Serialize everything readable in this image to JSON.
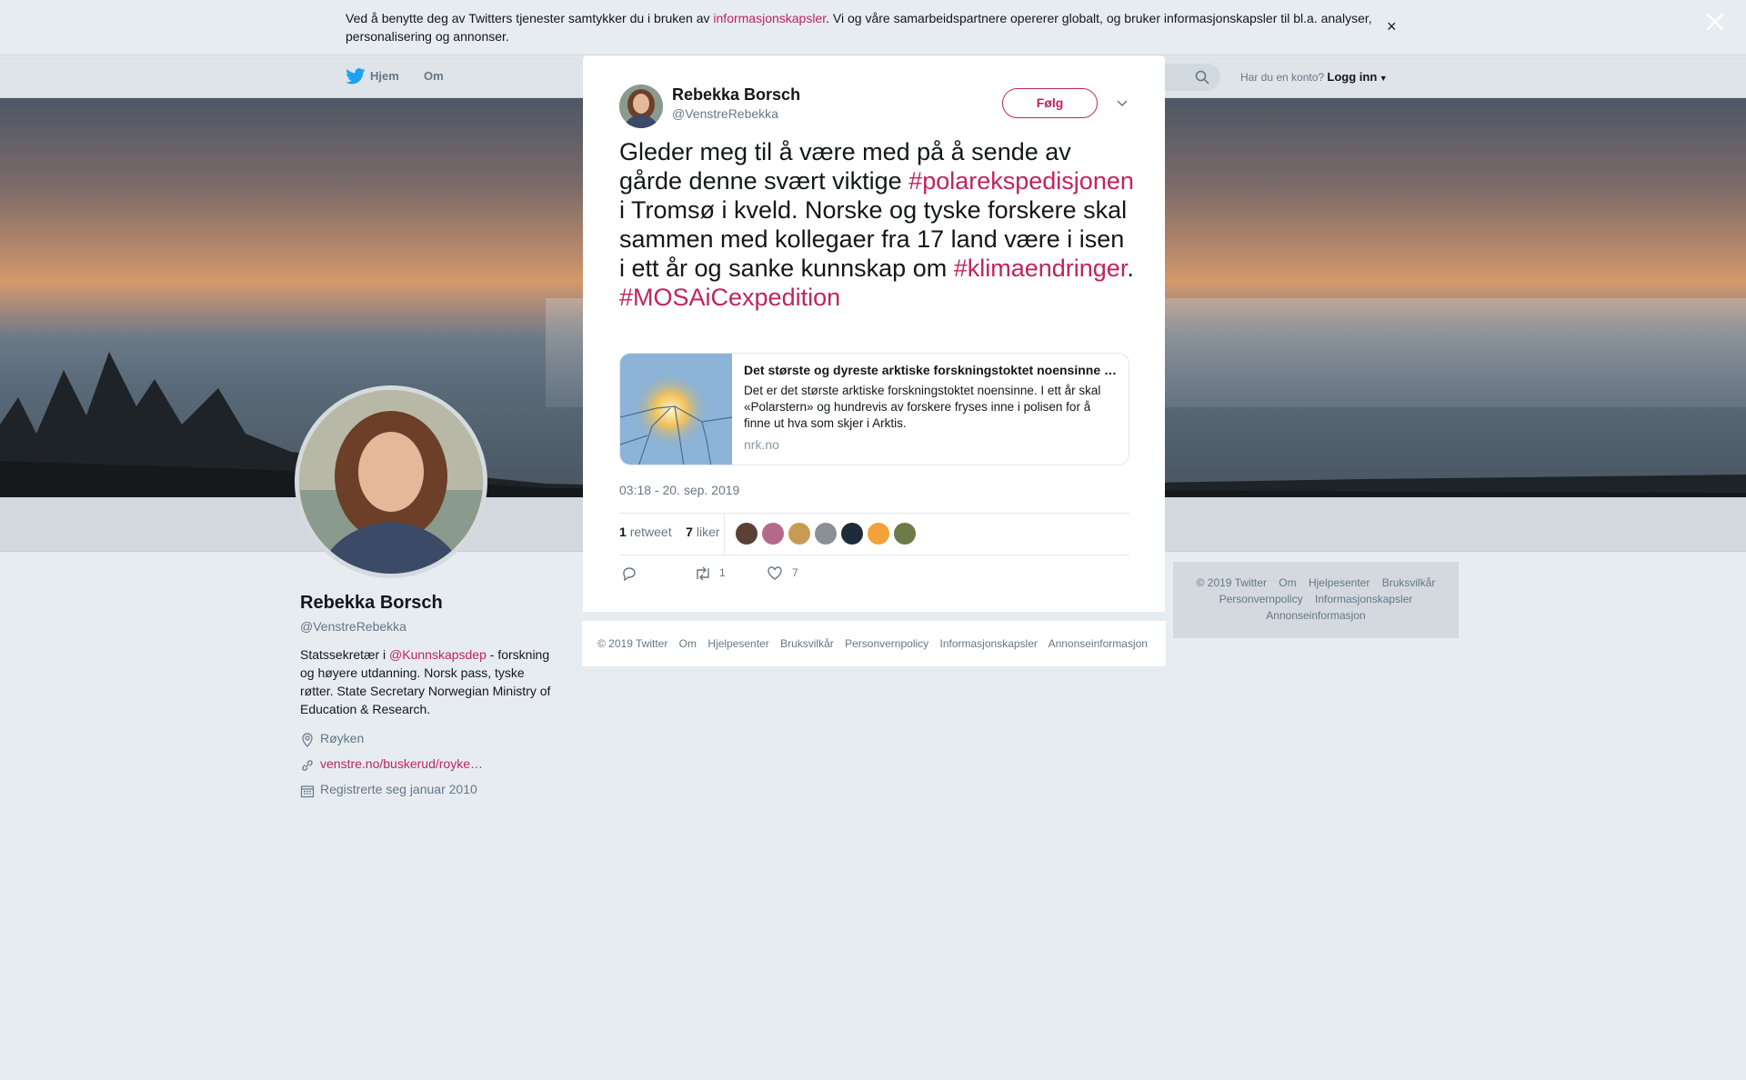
{
  "cookie": {
    "text_before": "Ved å benytte deg av Twitters tjenester samtykker du i bruken av ",
    "link": "informasjonskapsler",
    "text_after": ". Vi og våre samarbeidspartnere opererer globalt, og bruker informasjonskapsler til bl.a. analyser, personalisering og annonser.",
    "close": "×"
  },
  "nav": {
    "home": "Hjem",
    "about": "Om",
    "login_prompt": "Har du en konto?",
    "login": "Logg inn"
  },
  "profile": {
    "name": "Rebekka Borsch",
    "handle": "@VenstreRebekka",
    "bio_before": "Statssekretær i ",
    "bio_link": "@Kunnskapsdep",
    "bio_after": " - forskning og høyere utdanning. Norsk pass, tyske røtter. State Secretary Norwegian Ministry of Education & Research.",
    "location": "Røyken",
    "url": "venstre.no/buskerud/royke…",
    "joined": "Registrerte seg januar 2010"
  },
  "side_footer": {
    "row1": [
      "© 2019 Twitter",
      "Om",
      "Hjelpesenter",
      "Bruksvilkår"
    ],
    "row2": [
      "Personvernpolicy",
      "Informasjonskapsler"
    ],
    "row3": [
      "Annonseinformasjon"
    ]
  },
  "tweet": {
    "name": "Rebekka Borsch",
    "handle": "@VenstreRebekka",
    "follow": "Følg",
    "text_1": "Gleder meg til å være med på å sende av gårde denne svært viktige ",
    "tag_1": "#polarekspedisjonen",
    "text_2": " i Tromsø i kveld. Norske og tyske forskere skal sammen med kollegaer fra 17 land være i isen i ett år og sanke kunnskap om ",
    "tag_2": "#klimaendringer",
    "text_3": ". ",
    "tag_3": "#MOSAiCexpedition",
    "card": {
      "title": "Det største og dyreste arktiske forskningstoktet noensinne …",
      "description": "Det er det største arktiske forskningstoktet noensinne. I ett år skal «Polarstern» og hundrevis av forskere fryses inne i polisen for å finne ut hva som skjer i Arktis.",
      "domain": "nrk.no"
    },
    "time": "03:18 - 20. sep. 2019",
    "retweets": "1",
    "retweets_label": "retweet",
    "likes": "7",
    "likes_label": "liker",
    "action_retweets": "1",
    "action_likes": "7"
  },
  "modal_footer": [
    "© 2019 Twitter",
    "Om",
    "Hjelpesenter",
    "Bruksvilkår",
    "Personvernpolicy",
    "Informasjonskapsler",
    "Annonseinformasjon"
  ],
  "colors": {
    "accent": "#c0245c",
    "text": "#14171a",
    "muted": "#657786",
    "background": "#e6ecf0"
  }
}
